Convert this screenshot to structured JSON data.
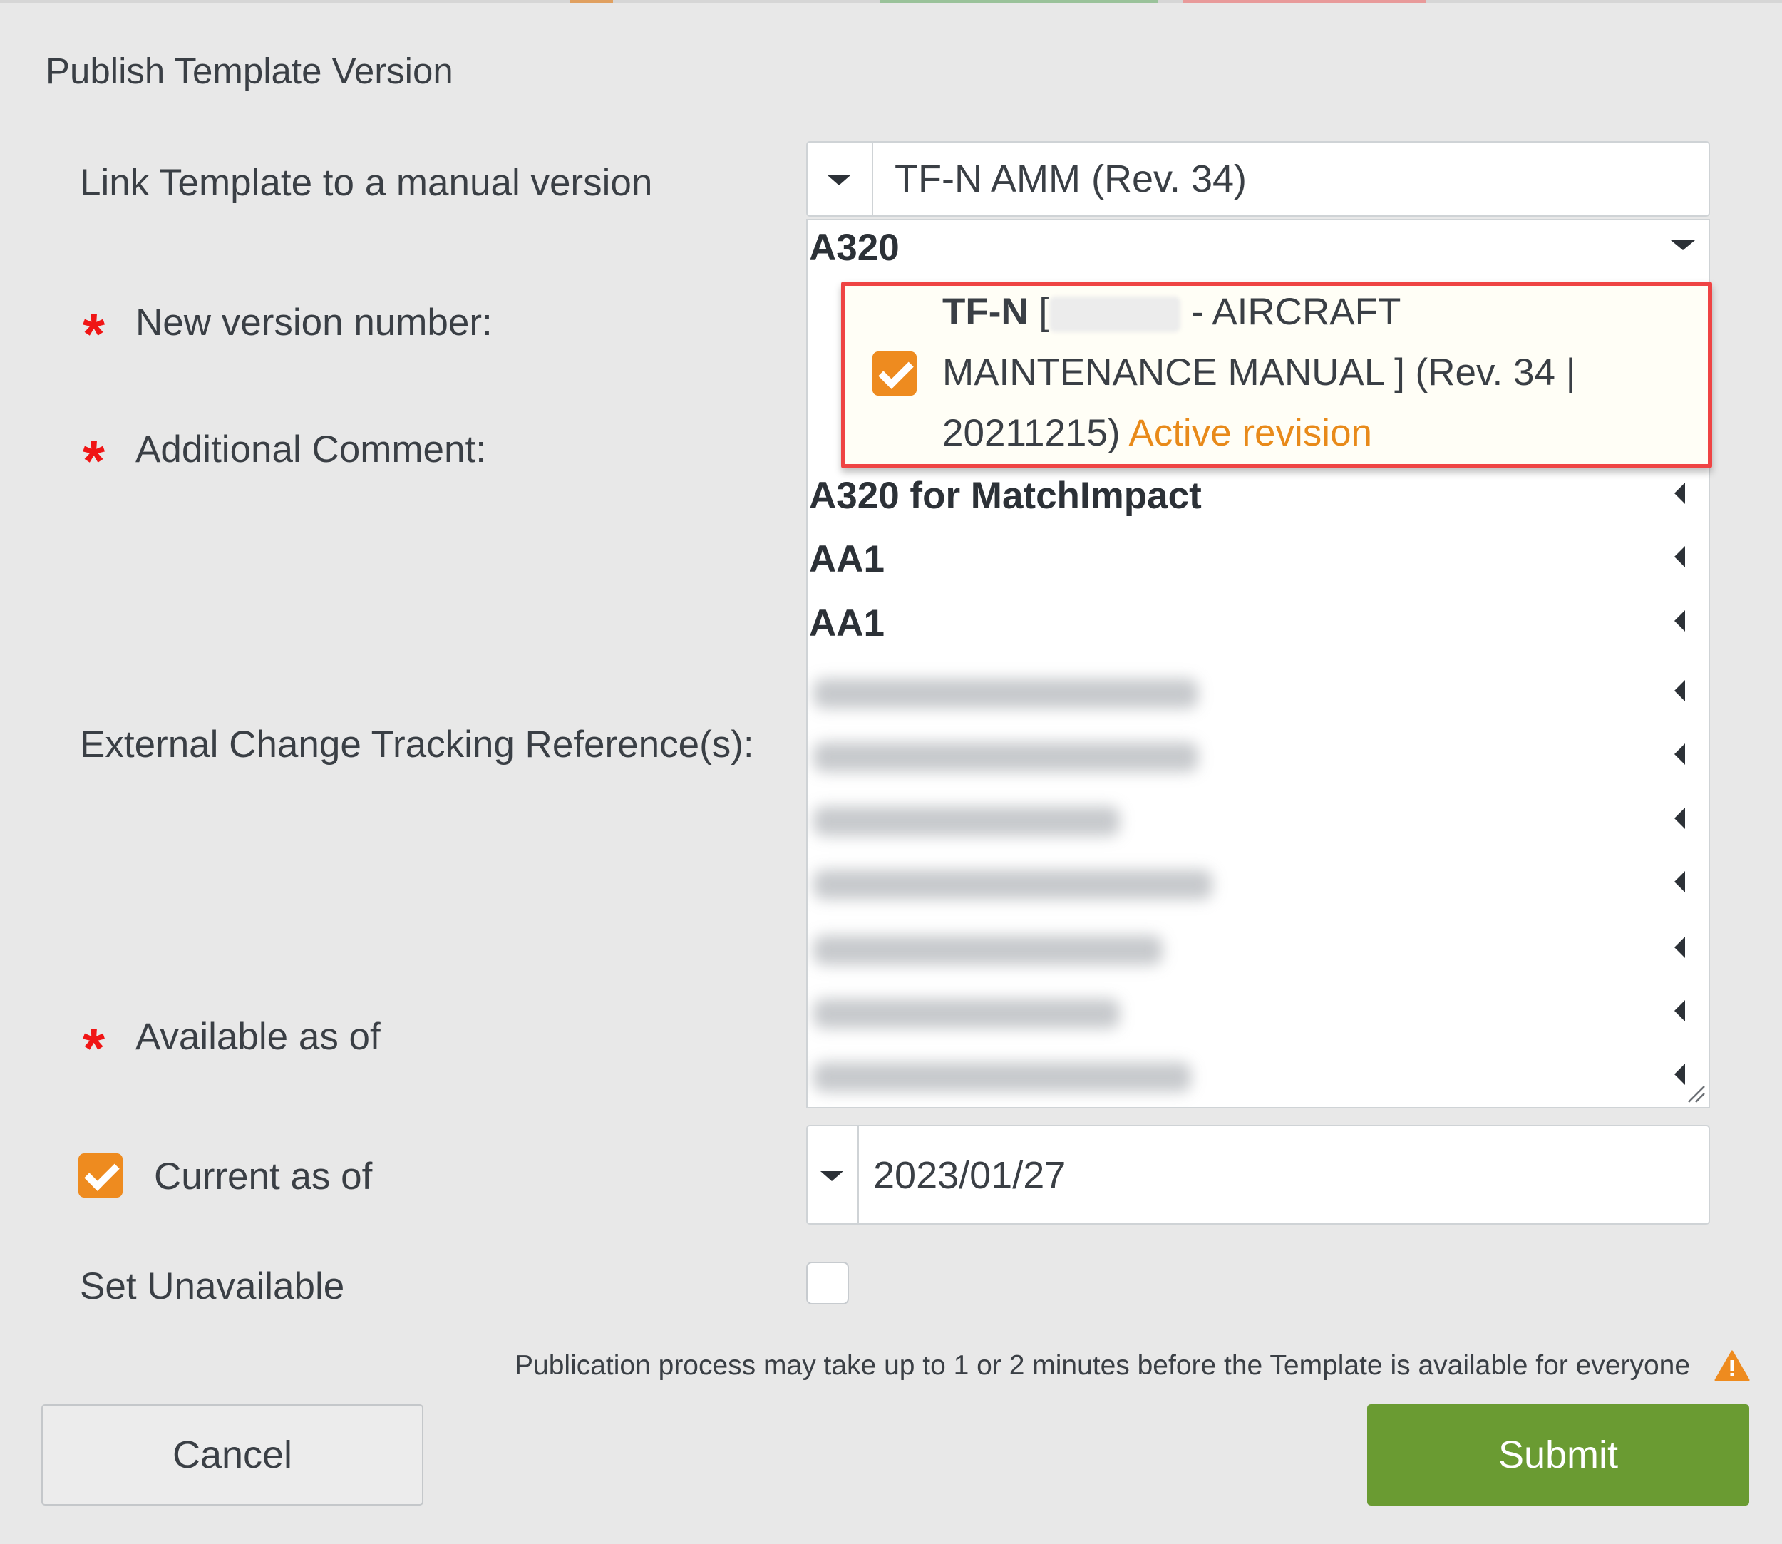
{
  "dialog": {
    "title": "Publish Template Version",
    "fields": {
      "link_template_label": "Link Template to a manual version",
      "new_version_label": "New version number:",
      "additional_comment_label": "Additional Comment:",
      "external_refs_label": "External Change Tracking Reference(s):",
      "available_as_of_label": "Available as of",
      "current_as_of_label": "Current as of",
      "set_unavailable_label": "Set Unavailable",
      "required_marker": "*"
    },
    "manual_select": {
      "value": "TF-N AMM (Rev. 34)"
    },
    "tree": {
      "expanded_group": "A320",
      "selected_leaf": {
        "line1_bold": "TF-N",
        "line1_rest": "- AIRCRAFT",
        "line2": "MAINTENANCE MANUAL ] (Rev. 34 |",
        "line3": "20211215)",
        "status": "Active revision",
        "checked": true
      },
      "groups": [
        "A320 for MatchImpact",
        "AA1",
        "AA1"
      ],
      "blurred_group_count": 7
    },
    "current_as_of": {
      "checked": true,
      "date": "2023/01/27"
    },
    "set_unavailable": {
      "checked": false
    },
    "notice": "Publication process may take up to 1 or 2 minutes before the Template is available for everyone",
    "buttons": {
      "cancel": "Cancel",
      "submit": "Submit"
    }
  },
  "colors": {
    "accent_orange": "#ee8b1f",
    "submit_green": "#6a9b32",
    "required_red": "#f01515",
    "highlight_red": "#ef4444"
  }
}
